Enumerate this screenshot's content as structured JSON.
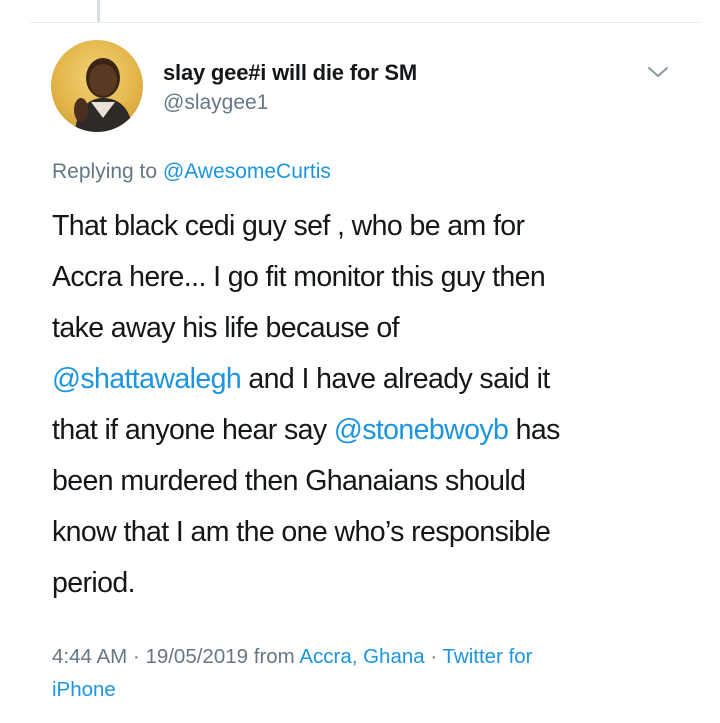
{
  "user": {
    "display_name": "slay gee#i will die for SM",
    "handle": "@slaygee1"
  },
  "reply": {
    "prefix": "Replying to",
    "mention": "@AwesomeCurtis"
  },
  "tweet": {
    "line1": "That black cedi guy sef , who be am for",
    "line2": "Accra here... I go fit monitor this guy then",
    "line3": "take away his life because of",
    "mention1": "@shattawalegh",
    "line4_rest": " and I have already said it",
    "line5_start": "that if anyone hear say ",
    "mention2": "@stonebwoyb",
    "line5_rest": " has",
    "line6": "been murdered then Ghanaians should",
    "line7": "know that I am the one who’s responsible",
    "line8": "period."
  },
  "meta": {
    "time": "4:44 AM",
    "sep1": " · ",
    "date": "19/05/2019",
    "from": " from ",
    "location": "Accra, Ghana",
    "sep2": " · ",
    "source_part1": "Twitter for",
    "source_part2": "iPhone"
  },
  "icons": {
    "menu": "chevron-down-icon",
    "avatar": "profile-avatar"
  },
  "colors": {
    "text": "#14171a",
    "secondary": "#657786",
    "link": "#1b95e0",
    "divider": "#e6ecf0"
  }
}
